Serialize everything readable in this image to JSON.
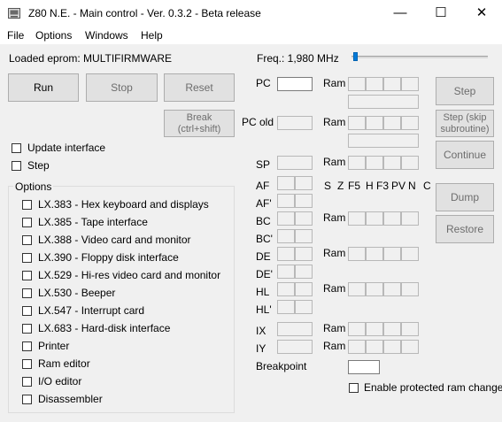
{
  "window": {
    "title": "Z80 N.E. - Main control - Ver. 0.3.2 - Beta release",
    "minimize": "—",
    "maximize": "☐",
    "close": "✕"
  },
  "menu": [
    "File",
    "Options",
    "Windows",
    "Help"
  ],
  "loaded_eprom": "Loaded eprom: MULTIFIRMWARE",
  "freq": {
    "label": "Freq.: 1,980 MHz",
    "slider_level": 0.0
  },
  "buttons": {
    "run": "Run",
    "stop": "Stop",
    "reset": "Reset",
    "break": "Break\n(ctrl+shift)",
    "step": "Step",
    "step_skip": "Step (skip\nsubroutine)",
    "continue": "Continue",
    "dump": "Dump",
    "restore": "Restore"
  },
  "checks": {
    "update_interface": "Update interface",
    "step": "Step",
    "enable_protected": "Enable protected ram change"
  },
  "options": {
    "title": "Options",
    "items": [
      "LX.383 - Hex keyboard and displays",
      "LX.385 - Tape interface",
      "LX.388 - Video card and monitor",
      "LX.390 - Floppy disk interface",
      "LX.529 - Hi-res video card and monitor",
      "LX.530 - Beeper",
      "LX.547 - Interrupt card",
      "LX.683 - Hard-disk interface",
      "Printer",
      "Ram editor",
      "I/O editor",
      "Disassembler"
    ]
  },
  "registers": {
    "pc": "PC",
    "pc_old": "PC old",
    "sp": "SP",
    "af": "AF",
    "af2": "AF'",
    "bc": "BC",
    "bc2": "BC'",
    "de": "DE",
    "de2": "DE'",
    "hl": "HL",
    "hl2": "HL'",
    "ix": "IX",
    "iy": "IY",
    "ram": "Ram",
    "flags": [
      "S",
      "Z",
      "F5",
      "H",
      "F3",
      "PV",
      "N",
      "C"
    ],
    "breakpoint": "Breakpoint"
  }
}
